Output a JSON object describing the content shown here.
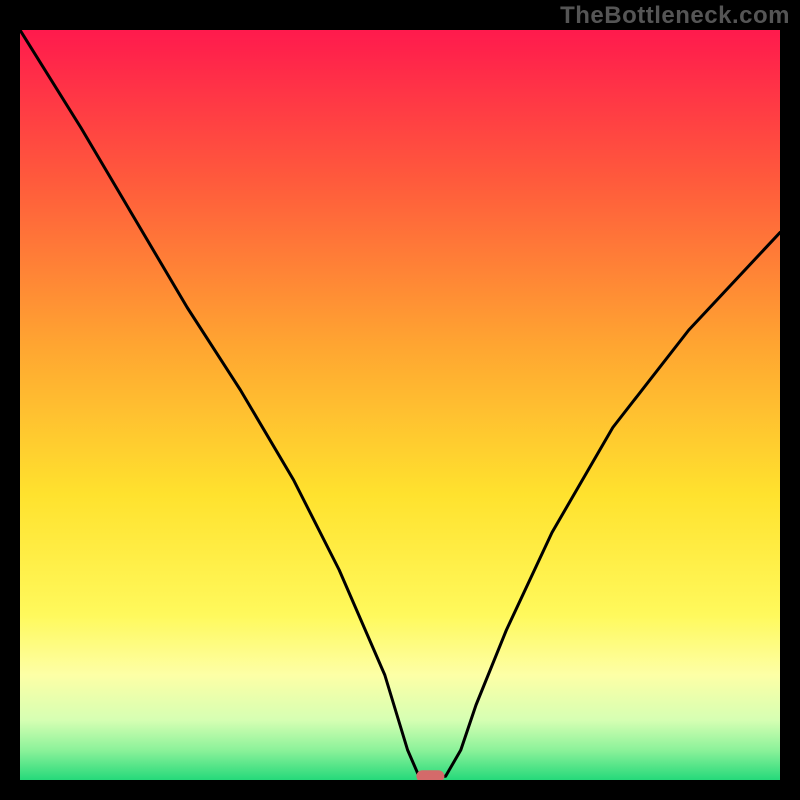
{
  "watermark": "TheBottleneck.com",
  "chart_data": {
    "type": "line",
    "title": "",
    "xlabel": "",
    "ylabel": "",
    "xlim": [
      0,
      100
    ],
    "ylim": [
      0,
      100
    ],
    "grid": false,
    "legend": false,
    "series": [
      {
        "name": "bottleneck-curve",
        "x": [
          0,
          8,
          15,
          22,
          29,
          36,
          42,
          48,
          51,
          52.5,
          54,
          56,
          58,
          60,
          64,
          70,
          78,
          88,
          100
        ],
        "values": [
          100,
          87,
          75,
          63,
          52,
          40,
          28,
          14,
          4,
          0.5,
          0.5,
          0.5,
          4,
          10,
          20,
          33,
          47,
          60,
          73
        ]
      }
    ],
    "marker": {
      "name": "optimal-point-pill",
      "x": 54,
      "y": 0.5,
      "color": "#d46a6a"
    },
    "background_gradient": {
      "stops": [
        {
          "offset": 0.0,
          "color": "#ff1a4d"
        },
        {
          "offset": 0.2,
          "color": "#ff5a3c"
        },
        {
          "offset": 0.42,
          "color": "#ffa531"
        },
        {
          "offset": 0.62,
          "color": "#ffe22e"
        },
        {
          "offset": 0.78,
          "color": "#fff95c"
        },
        {
          "offset": 0.86,
          "color": "#fdffa6"
        },
        {
          "offset": 0.92,
          "color": "#d6ffb3"
        },
        {
          "offset": 0.96,
          "color": "#8cf29a"
        },
        {
          "offset": 1.0,
          "color": "#25d97a"
        }
      ]
    }
  }
}
